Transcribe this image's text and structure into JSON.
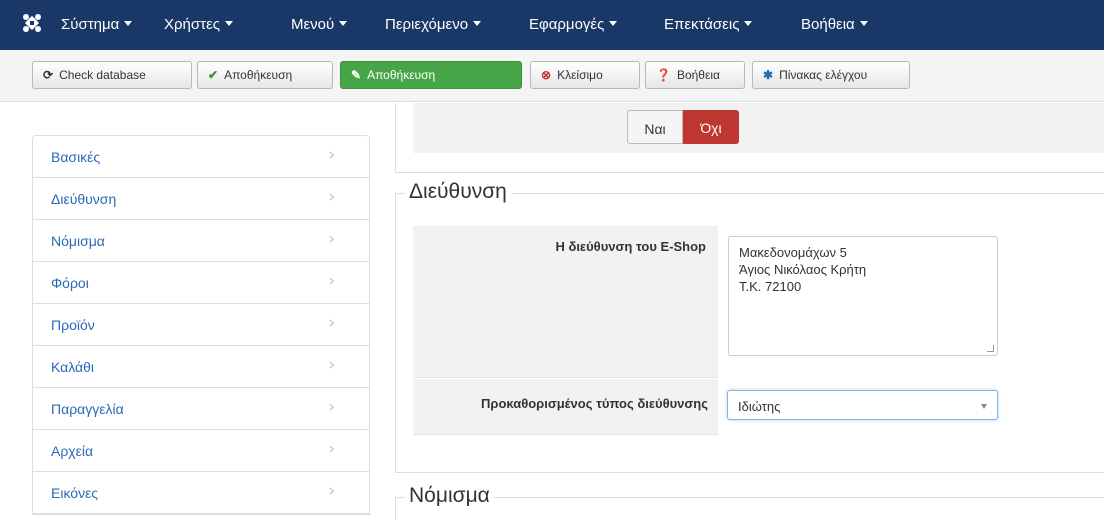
{
  "navbar": {
    "logo_icon": "joomla-icon",
    "menus": [
      {
        "label": "Σύστημα"
      },
      {
        "label": "Χρήστες"
      },
      {
        "label": "Μενού"
      },
      {
        "label": "Περιεχόμενο"
      },
      {
        "label": "Εφαρμογές"
      },
      {
        "label": "Επεκτάσεις"
      },
      {
        "label": "Βοήθεια"
      }
    ]
  },
  "toolbar": {
    "check_db": {
      "label": "Check database",
      "icon": "refresh-icon"
    },
    "save": {
      "label": "Αποθήκευση",
      "icon": "check-icon"
    },
    "save_primary": {
      "label": "Αποθήκευση",
      "icon": "edit-icon",
      "color": "#46a546"
    },
    "close": {
      "label": "Κλείσιμο",
      "icon": "cancel-icon",
      "color": "#bd362f"
    },
    "help": {
      "label": "Βοήθεια",
      "icon": "question-icon"
    },
    "control_panel": {
      "label": "Πίνακας ελέγχου",
      "icon": "asterisk-icon",
      "color": "#2a69b8"
    }
  },
  "top_toggle": {
    "yes_label": "Ναι",
    "no_label": "Όχι",
    "active": "no"
  },
  "sidebar": {
    "items": [
      {
        "label": "Βασικές"
      },
      {
        "label": "Διεύθυνση"
      },
      {
        "label": "Νόμισμα"
      },
      {
        "label": "Φόροι"
      },
      {
        "label": "Προϊόν"
      },
      {
        "label": "Καλάθι"
      },
      {
        "label": "Παραγγελία"
      },
      {
        "label": "Αρχεία"
      },
      {
        "label": "Εικόνες"
      }
    ]
  },
  "address_section": {
    "legend": "Διεύθυνση",
    "shop_address_label": "Η διεύθυνση του E-Shop",
    "shop_address_value": "Μακεδονομάχων 5\nΆγιος Νικόλαος Κρήτη\nΤ.Κ. 72100",
    "default_type_label": "Προκαθορισμένος τύπος διεύθυνσης",
    "default_type_value": "Ιδιώτης"
  },
  "currency_section": {
    "legend": "Νόμισμα"
  }
}
